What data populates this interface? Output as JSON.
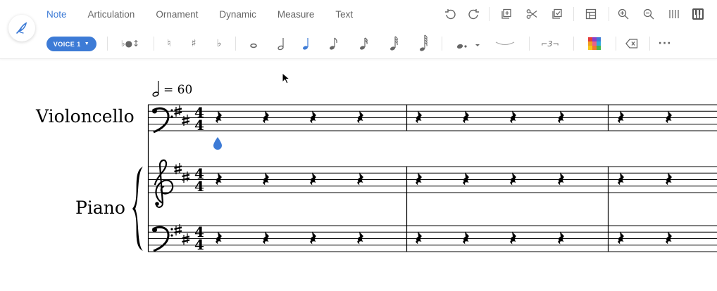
{
  "tabs": [
    {
      "label": "Note",
      "active": true
    },
    {
      "label": "Articulation",
      "active": false
    },
    {
      "label": "Ornament",
      "active": false
    },
    {
      "label": "Dynamic",
      "active": false
    },
    {
      "label": "Measure",
      "active": false
    },
    {
      "label": "Text",
      "active": false
    }
  ],
  "actions": [
    "undo-icon",
    "redo-icon",
    "duplicate-icon",
    "cut-icon",
    "paste-icon",
    "layout-icon",
    "zoom-in-icon",
    "zoom-out-icon",
    "bars-icon",
    "piano-icon"
  ],
  "voice": {
    "label": "VOICE 1"
  },
  "note_tools": {
    "flip_label": "♭●↕",
    "natural": "♮",
    "sharp": "♯",
    "flat": "♭",
    "triplet": "⌐3¬"
  },
  "score": {
    "tempo": "= 60",
    "instruments": [
      "Violoncello",
      "Piano"
    ],
    "time_signature": "4/4",
    "key": "2 sharps",
    "measures_visible": 3
  },
  "colors": {
    "accent": "#3d7bd6",
    "ink": "#000000",
    "tab_inactive": "#666666"
  }
}
